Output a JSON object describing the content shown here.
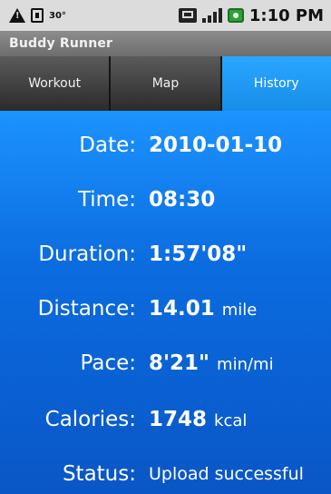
{
  "status_bar": {
    "temperature": "30°",
    "time": "1:10 PM",
    "icons": [
      "warning-icon",
      "usb-icon",
      "sim-icon",
      "signal-icon",
      "battery-icon"
    ]
  },
  "app": {
    "title": "Buddy Runner"
  },
  "tabs": [
    {
      "label": "Workout",
      "active": false
    },
    {
      "label": "Map",
      "active": false
    },
    {
      "label": "History",
      "active": true
    }
  ],
  "history": {
    "date": {
      "label": "Date:",
      "value": "2010-01-10"
    },
    "time": {
      "label": "Time:",
      "value": "08:30"
    },
    "duration": {
      "label": "Duration:",
      "value": "1:57'08\""
    },
    "distance": {
      "label": "Distance:",
      "value": "14.01",
      "unit": "mile"
    },
    "pace": {
      "label": "Pace:",
      "value": "8'21\"",
      "unit": "min/mi"
    },
    "calories": {
      "label": "Calories:",
      "value": "1748",
      "unit": "kcal"
    },
    "status": {
      "label": "Status:",
      "value": "Upload successful"
    }
  },
  "colors": {
    "active_tab": "#1e9cff",
    "content_top": "#1c93ff",
    "content_bottom": "#0a56c6"
  }
}
